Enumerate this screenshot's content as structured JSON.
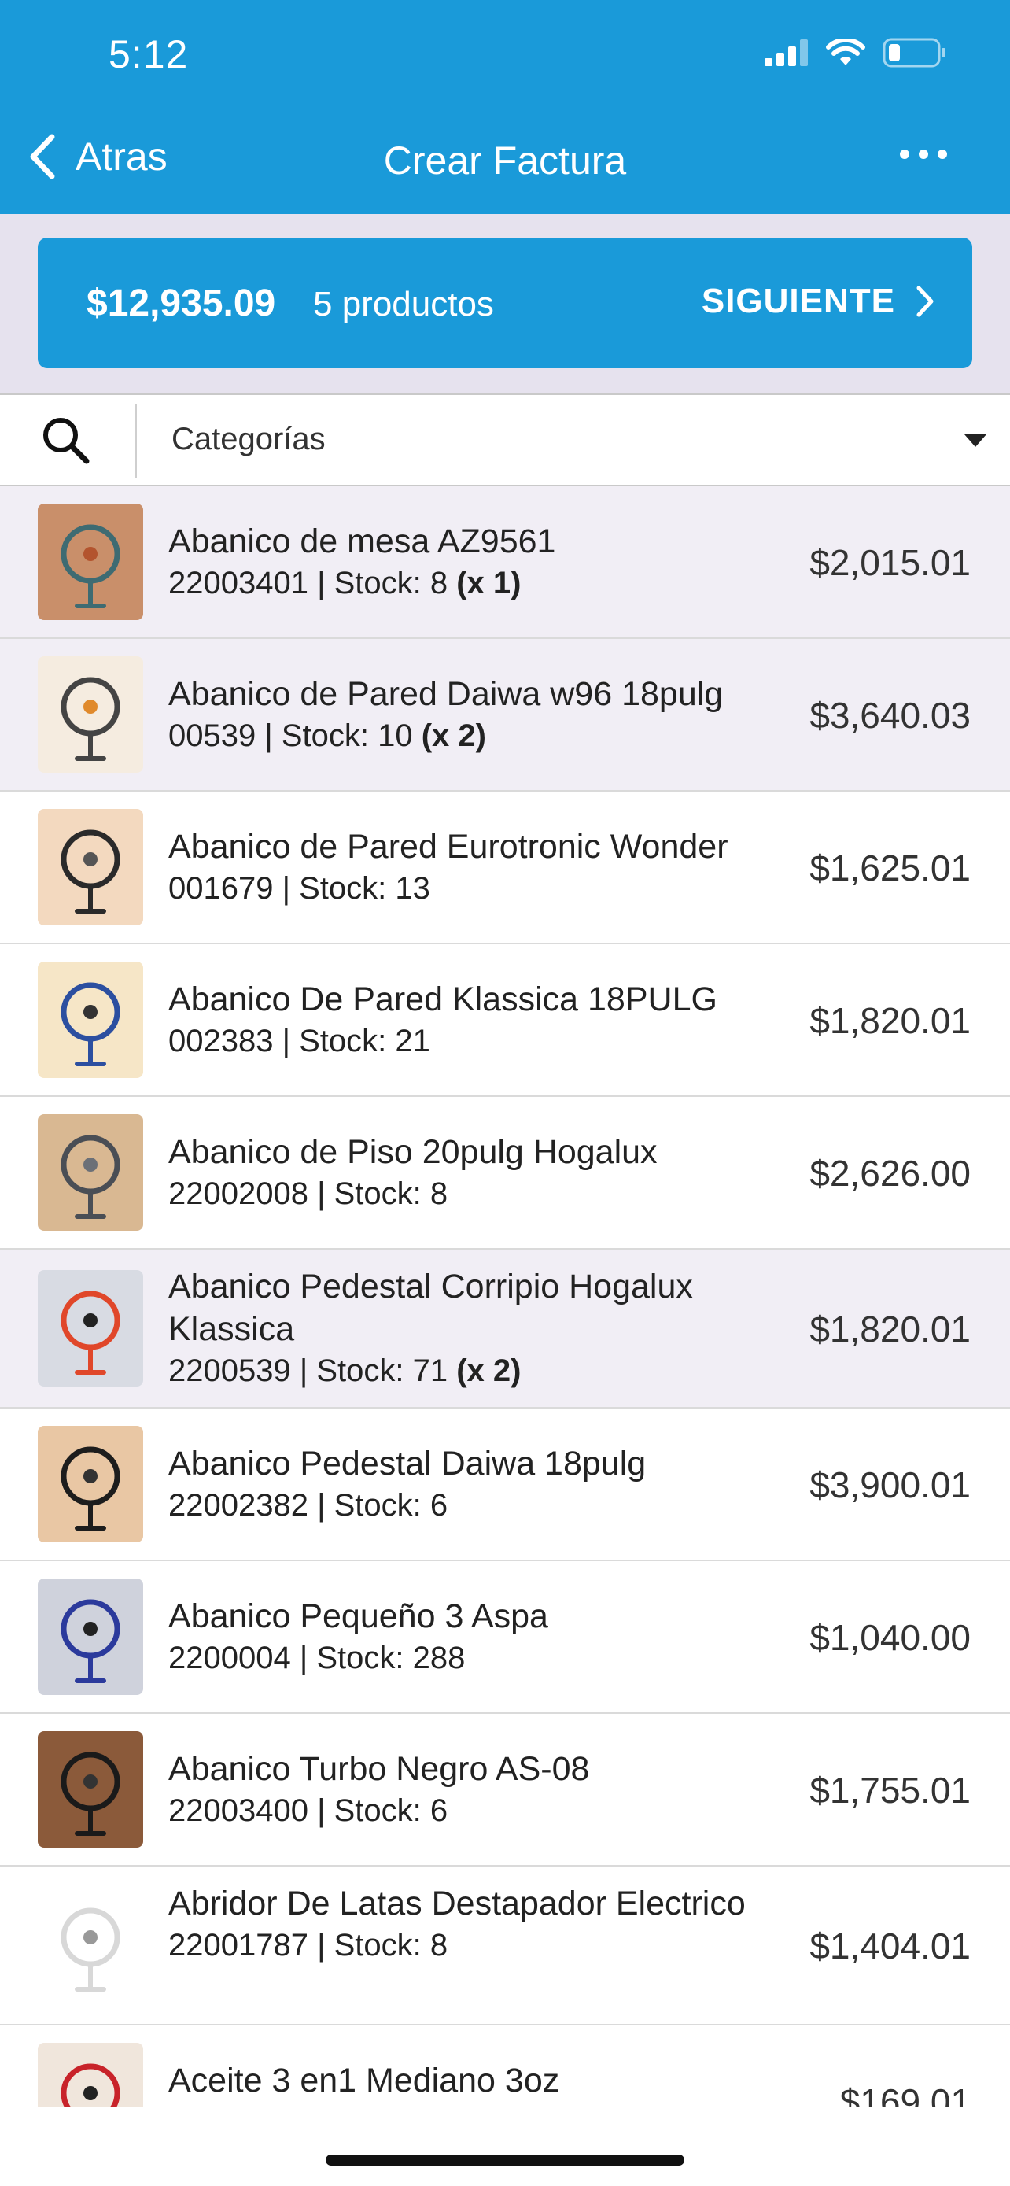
{
  "status": {
    "time": "5:12",
    "icons": [
      "signal-icon",
      "wifi-icon",
      "battery-icon"
    ]
  },
  "nav": {
    "back_label": "Atras",
    "title": "Crear Factura",
    "more": "more-icon"
  },
  "summary": {
    "total": "$12,935.09",
    "count": "5 productos",
    "next_label": "SIGUIENTE"
  },
  "search": {
    "category_label": "Categorías"
  },
  "colors": {
    "primary": "#1a9ad9",
    "selected_row": "#f1eef5",
    "summary_bg": "#e6e2ee"
  },
  "products": [
    {
      "name": "Abanico de mesa AZ9561",
      "meta": "22003401 | Stock: 8",
      "qty": "(x 1)",
      "price": "$2,015.01",
      "selected": true
    },
    {
      "name": "Abanico de Pared Daiwa w96 18pulg",
      "meta": "00539 | Stock: 10",
      "qty": "(x 2)",
      "price": "$3,640.03",
      "selected": true
    },
    {
      "name": "Abanico de Pared Eurotronic Wonder",
      "meta": "001679 | Stock: 13",
      "qty": "",
      "price": "$1,625.01",
      "selected": false
    },
    {
      "name": "Abanico De Pared Klassica 18PULG",
      "meta": "002383 | Stock: 21",
      "qty": "",
      "price": "$1,820.01",
      "selected": false
    },
    {
      "name": "Abanico de Piso 20pulg Hogalux",
      "meta": "22002008 | Stock: 8",
      "qty": "",
      "price": "$2,626.00",
      "selected": false
    },
    {
      "name": "Abanico Pedestal Corripio Hogalux Klassica",
      "meta": "2200539 | Stock: 71",
      "qty": "(x 2)",
      "price": "$1,820.01",
      "selected": true
    },
    {
      "name": "Abanico Pedestal Daiwa 18pulg",
      "meta": "22002382 | Stock: 6",
      "qty": "",
      "price": "$3,900.01",
      "selected": false
    },
    {
      "name": "Abanico Pequeño 3 Aspa",
      "meta": "2200004 | Stock: 288",
      "qty": "",
      "price": "$1,040.00",
      "selected": false
    },
    {
      "name": "Abanico Turbo Negro AS-08",
      "meta": "22003400 | Stock: 6",
      "qty": "",
      "price": "$1,755.01",
      "selected": false
    },
    {
      "name": "Abridor De Latas Destapador Electrico",
      "meta": "22001787 | Stock: 8",
      "qty": "",
      "price": "$1,404.01",
      "selected": false
    },
    {
      "name": "Aceite 3 en1 Mediano 3oz",
      "meta": "",
      "qty": "",
      "price": "$169.01",
      "selected": false
    }
  ]
}
